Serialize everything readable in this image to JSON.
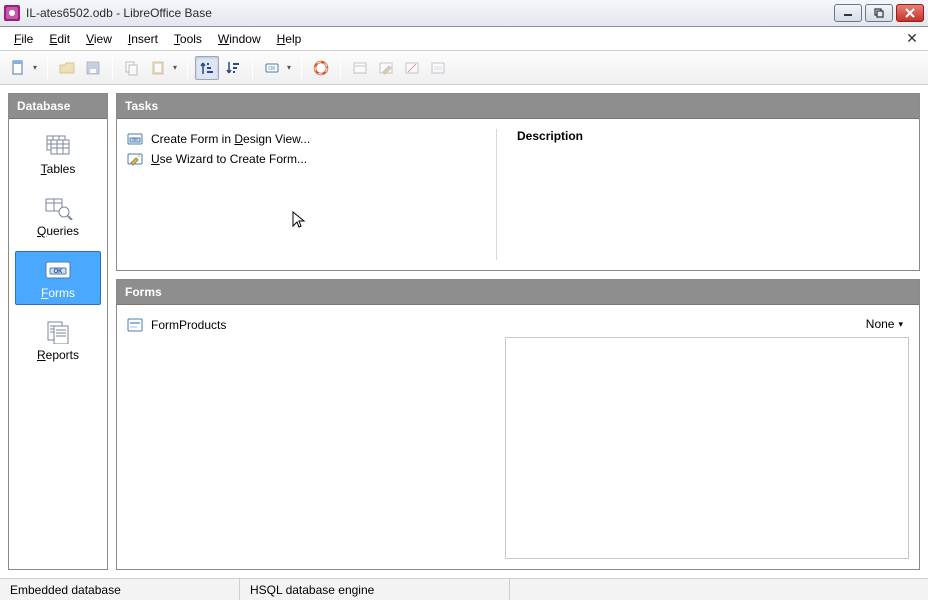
{
  "titlebar": {
    "title": "IL-ates6502.odb - LibreOffice Base"
  },
  "menubar": {
    "items": [
      "File",
      "Edit",
      "View",
      "Insert",
      "Tools",
      "Window",
      "Help"
    ]
  },
  "sidebar": {
    "header": "Database",
    "items": [
      {
        "label": "Tables",
        "underline": "T",
        "selected": false
      },
      {
        "label": "Queries",
        "underline": "Q",
        "selected": false
      },
      {
        "label": "Forms",
        "underline": "F",
        "selected": true
      },
      {
        "label": "Reports",
        "underline": "R",
        "selected": false
      }
    ]
  },
  "tasks": {
    "header": "Tasks",
    "items": [
      {
        "label": "Create Form in Design View...",
        "underline": "D"
      },
      {
        "label": "Use Wizard to Create Form...",
        "underline": "U"
      }
    ],
    "description_label": "Description"
  },
  "forms_panel": {
    "header": "Forms",
    "items": [
      {
        "label": "FormProducts"
      }
    ],
    "preview_mode": "None"
  },
  "statusbar": {
    "cell1": "Embedded database",
    "cell2": "HSQL database engine"
  }
}
